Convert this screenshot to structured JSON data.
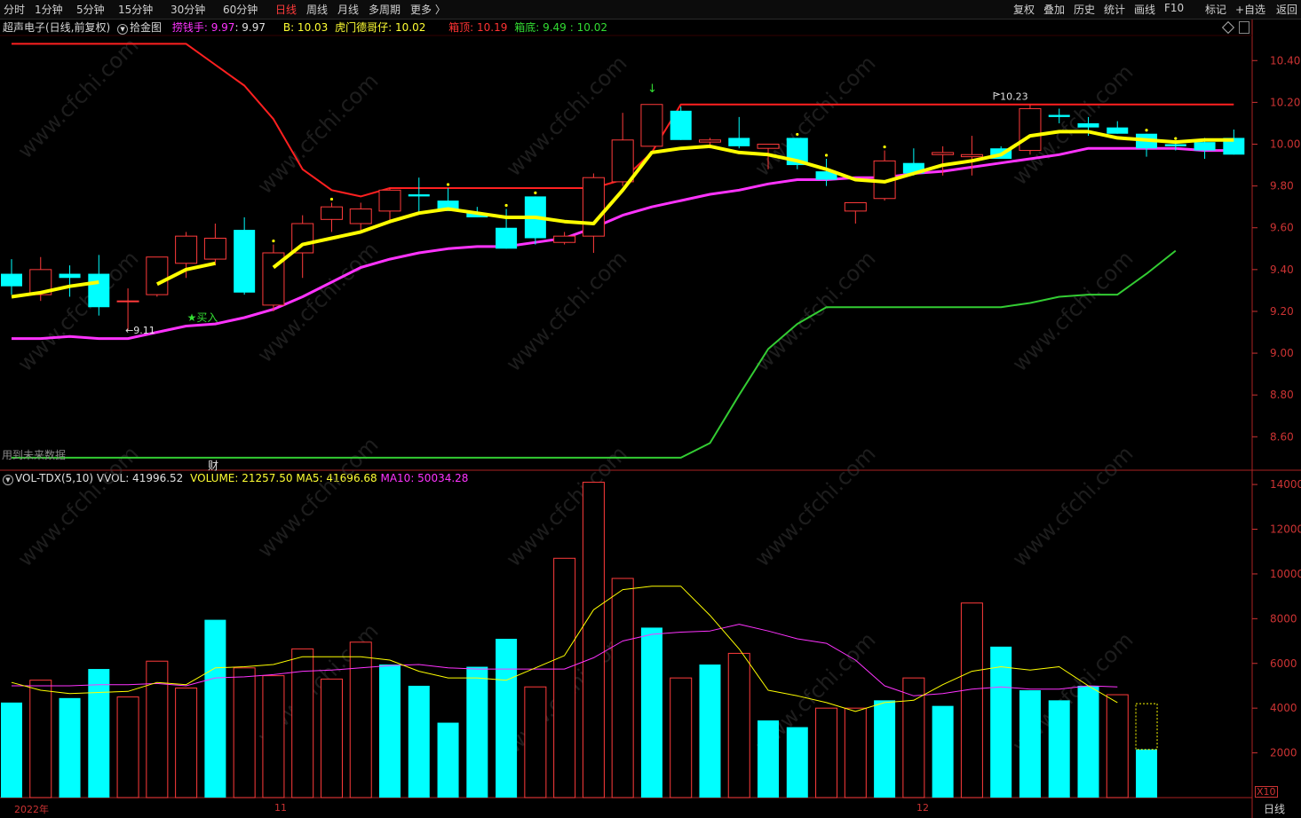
{
  "toolbar": {
    "periods": [
      "分时",
      "1分钟",
      "5分钟",
      "15分钟",
      "30分钟",
      "60分钟",
      "日线",
      "周线",
      "月线",
      "多周期",
      "更多 〉"
    ],
    "active_period": "日线",
    "right_buttons": [
      "复权",
      "叠加",
      "历史",
      "统计",
      "画线",
      "F10",
      "标记",
      "+自选",
      "返回"
    ]
  },
  "main_header": {
    "stock_name": "超声电子(日线,前复权)",
    "indicator_name": "拾金图",
    "laoqian_label": "捞钱手: 9.97",
    "laoqian_value": ": 9.97",
    "b_label": "B: 10.03",
    "humen_label": "虎门德哥仔: 10.02",
    "xiangding_label": "箱顶: 10.19",
    "xiangdi_label": "箱底: 9.49",
    "xiangdi_value": ": 10.02"
  },
  "main_notes": {
    "future_data": "用到未来数据",
    "cai_marker": "财",
    "buy_marker": "★买入",
    "low_marker": "←9.11",
    "high_marker": "10.23"
  },
  "vol_header": {
    "indicator": "VOL-TDX(5,10)",
    "vvol": "VVOL: 41996.52",
    "volume": "VOLUME: 21257.50",
    "ma5": "MA5: 41696.68",
    "ma10": "MA10: 50034.28"
  },
  "axis_units": {
    "vol_multiplier": "X10"
  },
  "bottom_labels": {
    "year": "2022年",
    "m11": "11",
    "m12": "12",
    "period": "日线"
  },
  "colors": {
    "up": "#ff3b3b",
    "down": "#00ffff",
    "yellow": "#ffff00",
    "magenta": "#ff33ff",
    "green": "#33cc33",
    "red": "#ff2020",
    "axis": "#cc3333"
  },
  "chart_data": [
    {
      "type": "candlestick",
      "title": "超声电子(日线,前复权)",
      "ylim": [
        8.44,
        10.52
      ],
      "y_ticks": [
        8.6,
        8.8,
        9.0,
        9.2,
        9.4,
        9.6,
        9.8,
        10.0,
        10.2,
        10.4
      ],
      "candles": [
        {
          "o": 9.38,
          "h": 9.45,
          "l": 9.28,
          "c": 9.32
        },
        {
          "o": 9.28,
          "h": 9.46,
          "l": 9.25,
          "c": 9.4
        },
        {
          "o": 9.38,
          "h": 9.42,
          "l": 9.27,
          "c": 9.36
        },
        {
          "o": 9.38,
          "h": 9.47,
          "l": 9.18,
          "c": 9.22
        },
        {
          "o": 9.25,
          "h": 9.31,
          "l": 9.11,
          "c": 9.25
        },
        {
          "o": 9.28,
          "h": 9.46,
          "l": 9.27,
          "c": 9.46
        },
        {
          "o": 9.43,
          "h": 9.58,
          "l": 9.36,
          "c": 9.56
        },
        {
          "o": 9.45,
          "h": 9.62,
          "l": 9.42,
          "c": 9.55
        },
        {
          "o": 9.59,
          "h": 9.65,
          "l": 9.28,
          "c": 9.29
        },
        {
          "o": 9.23,
          "h": 9.52,
          "l": 9.2,
          "c": 9.48
        },
        {
          "o": 9.48,
          "h": 9.66,
          "l": 9.36,
          "c": 9.62
        },
        {
          "o": 9.64,
          "h": 9.72,
          "l": 9.58,
          "c": 9.7
        },
        {
          "o": 9.62,
          "h": 9.72,
          "l": 9.59,
          "c": 9.69
        },
        {
          "o": 9.68,
          "h": 9.79,
          "l": 9.63,
          "c": 9.78
        },
        {
          "o": 9.76,
          "h": 9.84,
          "l": 9.67,
          "c": 9.75
        },
        {
          "o": 9.73,
          "h": 9.79,
          "l": 9.69,
          "c": 9.68
        },
        {
          "o": 9.67,
          "h": 9.7,
          "l": 9.65,
          "c": 9.65
        },
        {
          "o": 9.6,
          "h": 9.69,
          "l": 9.5,
          "c": 9.5
        },
        {
          "o": 9.75,
          "h": 9.75,
          "l": 9.52,
          "c": 9.55
        },
        {
          "o": 9.53,
          "h": 9.58,
          "l": 9.52,
          "c": 9.56
        },
        {
          "o": 9.56,
          "h": 9.86,
          "l": 9.48,
          "c": 9.84
        },
        {
          "o": 9.82,
          "h": 10.15,
          "l": 9.8,
          "c": 10.02
        },
        {
          "o": 9.99,
          "h": 10.19,
          "l": 9.99,
          "c": 10.19
        },
        {
          "o": 10.16,
          "h": 10.18,
          "l": 10.02,
          "c": 10.02
        },
        {
          "o": 10.01,
          "h": 10.03,
          "l": 9.98,
          "c": 10.02
        },
        {
          "o": 10.03,
          "h": 10.13,
          "l": 9.98,
          "c": 9.99
        },
        {
          "o": 9.98,
          "h": 10.0,
          "l": 9.88,
          "c": 10.0
        },
        {
          "o": 10.03,
          "h": 10.03,
          "l": 9.88,
          "c": 9.9
        },
        {
          "o": 9.87,
          "h": 9.93,
          "l": 9.8,
          "c": 9.83
        },
        {
          "o": 9.68,
          "h": 9.72,
          "l": 9.62,
          "c": 9.72
        },
        {
          "o": 9.74,
          "h": 9.97,
          "l": 9.73,
          "c": 9.92
        },
        {
          "o": 9.91,
          "h": 9.98,
          "l": 9.85,
          "c": 9.86
        },
        {
          "o": 9.95,
          "h": 9.99,
          "l": 9.85,
          "c": 9.96
        },
        {
          "o": 9.94,
          "h": 10.04,
          "l": 9.85,
          "c": 9.95
        },
        {
          "o": 9.98,
          "h": 9.99,
          "l": 9.93,
          "c": 9.93
        },
        {
          "o": 9.97,
          "h": 10.19,
          "l": 9.95,
          "c": 10.17
        },
        {
          "o": 10.14,
          "h": 10.17,
          "l": 10.1,
          "c": 10.13
        },
        {
          "o": 10.1,
          "h": 10.13,
          "l": 10.04,
          "c": 10.08
        },
        {
          "o": 10.08,
          "h": 10.11,
          "l": 10.05,
          "c": 10.05
        },
        {
          "o": 10.05,
          "h": 10.05,
          "l": 9.94,
          "c": 9.98
        },
        {
          "o": 10.0,
          "h": 10.01,
          "l": 9.97,
          "c": 9.99
        },
        {
          "o": 10.01,
          "h": 10.03,
          "l": 9.93,
          "c": 9.97
        },
        {
          "o": 10.03,
          "h": 10.07,
          "l": 9.95,
          "c": 9.95
        }
      ],
      "series": [
        {
          "name": "捞钱手",
          "values": [
            9.27,
            9.29,
            9.32,
            9.34,
            null,
            9.33,
            9.4,
            9.43,
            null,
            9.41,
            9.52,
            9.55,
            9.58,
            9.63,
            9.67,
            9.69,
            9.67,
            9.65,
            9.65,
            9.63,
            9.62,
            9.78,
            9.96,
            9.98,
            9.99,
            9.96,
            9.95,
            9.92,
            9.88,
            9.83,
            9.82,
            9.86,
            9.9,
            9.92,
            9.95,
            10.04,
            10.06,
            10.06,
            10.03,
            10.02,
            10.01,
            10.02,
            10.02
          ]
        },
        {
          "name": "B",
          "values": [
            9.07,
            9.07,
            9.08,
            9.07,
            9.07,
            9.1,
            9.13,
            9.14,
            9.17,
            9.21,
            9.27,
            9.34,
            9.41,
            9.45,
            9.48,
            9.5,
            9.51,
            9.51,
            9.53,
            9.55,
            9.6,
            9.66,
            9.7,
            9.73,
            9.76,
            9.78,
            9.81,
            9.83,
            9.83,
            9.84,
            9.84,
            9.86,
            9.87,
            9.89,
            9.91,
            9.93,
            9.95,
            9.98,
            9.98,
            9.98,
            9.98,
            9.97,
            9.97
          ]
        },
        {
          "name": "箱顶",
          "values": [
            10.48,
            10.48,
            10.48,
            10.48,
            10.48,
            10.48,
            10.48,
            10.38,
            10.28,
            10.12,
            9.88,
            9.78,
            9.75,
            9.79,
            9.79,
            9.79,
            9.79,
            9.79,
            9.79,
            9.79,
            9.79,
            9.83,
            9.96,
            10.19,
            10.19,
            10.19,
            10.19,
            10.19,
            10.19,
            10.19,
            10.19,
            10.19,
            10.19,
            10.19,
            10.19,
            10.19,
            10.19,
            10.19,
            10.19,
            10.19,
            10.19,
            10.19,
            10.19
          ]
        },
        {
          "name": "箱底",
          "values": [
            8.5,
            8.5,
            8.5,
            8.5,
            8.5,
            8.5,
            8.5,
            8.5,
            8.5,
            8.5,
            8.5,
            8.5,
            8.5,
            8.5,
            8.5,
            8.5,
            8.5,
            8.5,
            8.5,
            8.5,
            8.5,
            8.5,
            8.5,
            8.5,
            8.57,
            8.8,
            9.02,
            9.14,
            9.22,
            9.22,
            9.22,
            9.22,
            9.22,
            9.22,
            9.22,
            9.24,
            9.27,
            9.28,
            9.28,
            9.38,
            9.49,
            null,
            null
          ]
        }
      ]
    },
    {
      "type": "bar",
      "title": "VOL-TDX(5,10)",
      "ylim": [
        0,
        14400
      ],
      "y_ticks": [
        2000,
        4000,
        6000,
        8000,
        10000,
        12000,
        14000
      ],
      "values": [
        4250,
        5250,
        4450,
        5750,
        4500,
        6100,
        4900,
        7950,
        5800,
        5450,
        6650,
        5300,
        6950,
        5950,
        5000,
        3350,
        5850,
        7100,
        4950,
        10700,
        14100,
        9800,
        7600,
        5350,
        5950,
        6450,
        3450,
        3150,
        4000,
        4000,
        4350,
        5350,
        4100,
        8700,
        6750,
        4800,
        4350,
        5000,
        4600,
        2150
      ],
      "rising": [
        false,
        true,
        false,
        false,
        true,
        true,
        true,
        false,
        true,
        true,
        true,
        true,
        true,
        false,
        false,
        false,
        false,
        false,
        true,
        true,
        true,
        true,
        false,
        true,
        false,
        true,
        false,
        false,
        true,
        true,
        false,
        true,
        false,
        true,
        false,
        false,
        false,
        false,
        true,
        false
      ],
      "series": [
        {
          "name": "MA5",
          "values": [
            5150,
            4800,
            4650,
            4700,
            4750,
            5150,
            5050,
            5800,
            5850,
            5950,
            6300,
            6300,
            6300,
            6150,
            5650,
            5350,
            5350,
            5250,
            5800,
            6350,
            8400,
            9300,
            9450,
            9450,
            8150,
            6650,
            4800,
            4550,
            4250,
            3850,
            4250,
            4350,
            5050,
            5650,
            5850,
            5700,
            5850,
            5000,
            4250
          ]
        },
        {
          "name": "MA10",
          "values": [
            5000,
            5000,
            5000,
            5050,
            5050,
            5100,
            5000,
            5350,
            5400,
            5500,
            5650,
            5700,
            5800,
            5900,
            5950,
            5800,
            5750,
            5750,
            5750,
            5750,
            6250,
            7000,
            7300,
            7400,
            7450,
            7750,
            7450,
            7100,
            6900,
            6150,
            5000,
            4550,
            4650,
            4850,
            4950,
            4850,
            4850,
            5000,
            4950
          ]
        }
      ]
    }
  ]
}
